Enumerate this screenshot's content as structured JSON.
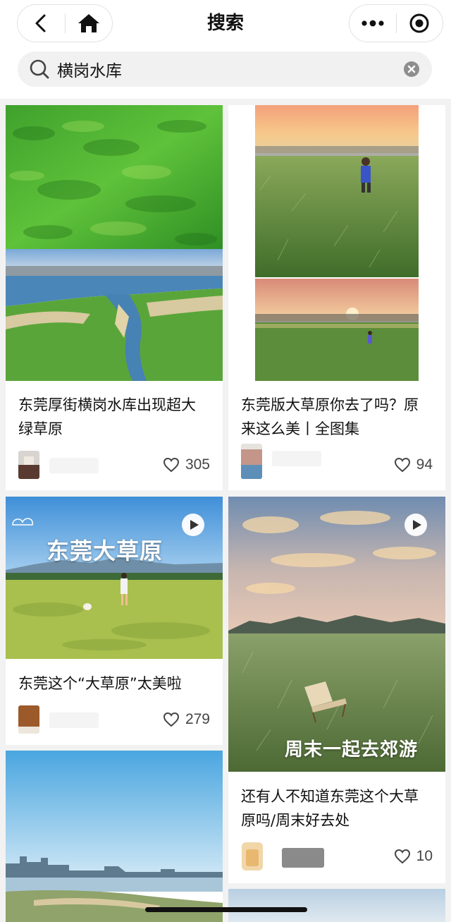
{
  "header": {
    "title": "搜索",
    "back_icon": "chevron-left-icon",
    "home_icon": "home-icon",
    "more_icon": "more-dots-icon",
    "close_icon": "target-circle-icon"
  },
  "search": {
    "value": "横岗水库",
    "placeholder": "",
    "search_icon": "search-icon",
    "clear_icon": "clear-icon"
  },
  "colors": {
    "accent_text": "#111111",
    "page_bg": "#f2f2f2",
    "card_bg": "#ffffff",
    "like_text": "#444444"
  },
  "cards": [
    {
      "title": "东莞厚街横岗水库出现超大绿草原",
      "likes": "305",
      "has_video": false,
      "overlay_text": ""
    },
    {
      "title": "东莞版大草原你去了吗？原来这么美丨全图集",
      "likes": "94",
      "has_video": false,
      "overlay_text": ""
    },
    {
      "title": "东莞这个“大草原”太美啦",
      "likes": "279",
      "has_video": true,
      "overlay_text": "东莞大草原"
    },
    {
      "title": "还有人不知道东莞这个大草原吗/周末好去处",
      "likes": "10",
      "has_video": true,
      "overlay_text": "周末一起去郊游"
    },
    {
      "title": "",
      "likes": "",
      "has_video": false,
      "overlay_text": ""
    },
    {
      "title": "",
      "likes": "",
      "has_video": false,
      "overlay_text": ""
    }
  ]
}
